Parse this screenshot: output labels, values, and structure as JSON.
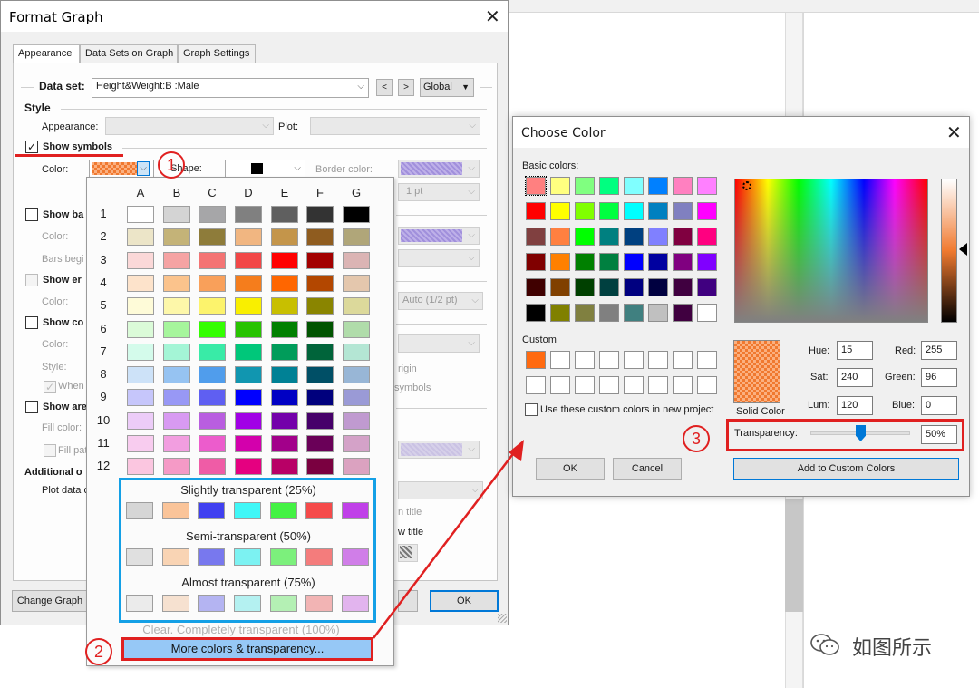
{
  "background": {
    "watermark_text": "如图所示"
  },
  "format_graph": {
    "title": "Format Graph",
    "tabs": [
      {
        "label": "Appearance"
      },
      {
        "label": "Data Sets on Graph"
      },
      {
        "label": "Graph Settings"
      }
    ],
    "data_set_label": "Data set:",
    "data_set_value": "Height&Weight:B :Male",
    "prev_label": "<",
    "next_label": ">",
    "global_label": "Global",
    "style_header": "Style",
    "appearance_label": "Appearance:",
    "plot_label": "Plot:",
    "show_symbols_label": "Show symbols",
    "color_label": "Color:",
    "shape_label": "Shape:",
    "border_color_label": "Border color:",
    "border_size_value": "1 pt",
    "show_bars_label": "Show ba",
    "bars_color_label": "Color:",
    "bars_begin_label": "Bars begi",
    "show_error_label": "Show er",
    "error_color_label": "Color:",
    "error_size_value": "Auto (1/2 pt)",
    "show_conn_label": "Show co",
    "conn_color_label": "Color:",
    "conn_style_label": "Style:",
    "when_label": "When",
    "origin_partial": "rigin",
    "symbols_partial": "symbols",
    "show_area_label": "Show are",
    "fill_color_label": "Fill color:",
    "fill_pattern_label": "Fill pat",
    "additional_header": "Additional o",
    "plot_data_label": "Plot data c",
    "title_partial_1": "n title",
    "title_partial_2": "w title",
    "change_graph_label": "Change Graph",
    "ok_label": "OK"
  },
  "palette": {
    "columns": [
      "A",
      "B",
      "C",
      "D",
      "E",
      "F",
      "G"
    ],
    "rows": [
      {
        "label": "1",
        "colors": [
          "#ffffff",
          "#d4d4d4",
          "#a6a6a8",
          "#808080",
          "#5f5f5f",
          "#333333",
          "#000000"
        ]
      },
      {
        "label": "2",
        "colors": [
          "#ece5c8",
          "#c4b378",
          "#8e7c3a",
          "#f1b681",
          "#c4954a",
          "#8f5c1f",
          "#b0a679"
        ]
      },
      {
        "label": "3",
        "colors": [
          "#fbd8d8",
          "#f5a3a3",
          "#f47474",
          "#f24747",
          "#ff0000",
          "#a30000",
          "#dbb4b4"
        ]
      },
      {
        "label": "4",
        "colors": [
          "#fde3cb",
          "#fbc38c",
          "#f9a05a",
          "#f57d1c",
          "#ff6600",
          "#b34700",
          "#e4c7ad"
        ]
      },
      {
        "label": "5",
        "colors": [
          "#fefbd8",
          "#fdf7a9",
          "#fcf36c",
          "#f9ef00",
          "#c8bf00",
          "#8a8500",
          "#dcd99b"
        ]
      },
      {
        "label": "6",
        "colors": [
          "#dbfbd8",
          "#a6f59c",
          "#33ff00",
          "#27c300",
          "#008000",
          "#005400",
          "#b0dcaa"
        ]
      },
      {
        "label": "7",
        "colors": [
          "#d4fbeb",
          "#a4f5d6",
          "#39eba7",
          "#00c77a",
          "#009c5a",
          "#00643a",
          "#b4e6d4"
        ]
      },
      {
        "label": "8",
        "colors": [
          "#cde2f8",
          "#96c3f2",
          "#509dec",
          "#1196b0",
          "#008195",
          "#004f66",
          "#98b6d6"
        ]
      },
      {
        "label": "9",
        "colors": [
          "#c6c6fb",
          "#9898f5",
          "#5f5ff2",
          "#0000ff",
          "#0000c4",
          "#00007d",
          "#9a9ad6"
        ]
      },
      {
        "label": "10",
        "colors": [
          "#ecccf8",
          "#d89af2",
          "#b95ee0",
          "#a100e6",
          "#7300aa",
          "#46006a",
          "#c09ad0"
        ]
      },
      {
        "label": "11",
        "colors": [
          "#f8ccef",
          "#f29ee0",
          "#ec5ccc",
          "#d300ac",
          "#a2008a",
          "#6a0058",
          "#d4a2c8"
        ]
      },
      {
        "label": "12",
        "colors": [
          "#fbc6e0",
          "#f59ac6",
          "#ef5ca6",
          "#e50080",
          "#b80066",
          "#7a0040",
          "#dba2c0"
        ]
      }
    ],
    "transparency_groups": [
      {
        "title": "Slightly transparent (25%)",
        "colors": [
          "#d6d6d6",
          "#fac499",
          "#4040f0",
          "#40f7f7",
          "#44f244",
          "#f54a4a",
          "#c040e8"
        ]
      },
      {
        "title": "Semi-transparent (50%)",
        "colors": [
          "#e0e0e0",
          "#f9d4b4",
          "#7878ee",
          "#7cf2f2",
          "#7cf07c",
          "#f47c7c",
          "#d07ee8"
        ]
      },
      {
        "title": "Almost transparent (75%)",
        "colors": [
          "#ebebeb",
          "#f6e1d0",
          "#b4b4f2",
          "#b4f1f1",
          "#b4f0b4",
          "#f2b4b4",
          "#e2b4ee"
        ]
      }
    ],
    "clear_label": "Clear. Completely transparent (100%)",
    "more_colors_label": "More colors & transparency..."
  },
  "choose_color": {
    "title": "Choose Color",
    "basic_colors_label": "Basic colors:",
    "basic_colors": [
      [
        "#ff8080",
        "#ffff80",
        "#80ff80",
        "#00ff80",
        "#80ffff",
        "#0080ff",
        "#ff80c0",
        "#ff80ff"
      ],
      [
        "#ff0000",
        "#ffff00",
        "#80ff00",
        "#00ff40",
        "#00ffff",
        "#0080c0",
        "#8080c0",
        "#ff00ff"
      ],
      [
        "#804040",
        "#ff8040",
        "#00ff00",
        "#008080",
        "#004080",
        "#8080ff",
        "#800040",
        "#ff0080"
      ],
      [
        "#800000",
        "#ff8000",
        "#008000",
        "#008040",
        "#0000ff",
        "#0000a0",
        "#800080",
        "#8000ff"
      ],
      [
        "#400000",
        "#804000",
        "#004000",
        "#004040",
        "#000080",
        "#000040",
        "#400040",
        "#400080"
      ],
      [
        "#000000",
        "#808000",
        "#808040",
        "#808080",
        "#408080",
        "#c0c0c0",
        "#400040",
        "#ffffff"
      ]
    ],
    "custom_label": "Custom",
    "custom_first_color": "#ff6a10",
    "use_custom_label": "Use these custom colors in new project",
    "solid_color_label": "Solid Color",
    "hue_label": "Hue:",
    "hue_value": "15",
    "sat_label": "Sat:",
    "sat_value": "240",
    "lum_label": "Lum:",
    "lum_value": "120",
    "red_label": "Red:",
    "red_value": "255",
    "green_label": "Green:",
    "green_value": "96",
    "blue_label": "Blue:",
    "blue_value": "0",
    "transparency_label": "Transparency:",
    "transparency_value": "50%",
    "transparency_level": 0.5,
    "ok_label": "OK",
    "cancel_label": "Cancel",
    "add_custom_label": "Add to Custom Colors"
  },
  "annotations": {
    "step1": "1",
    "step2": "2",
    "step3": "3",
    "highlight_color": "#e02020",
    "group_color": "#14a0e6"
  }
}
